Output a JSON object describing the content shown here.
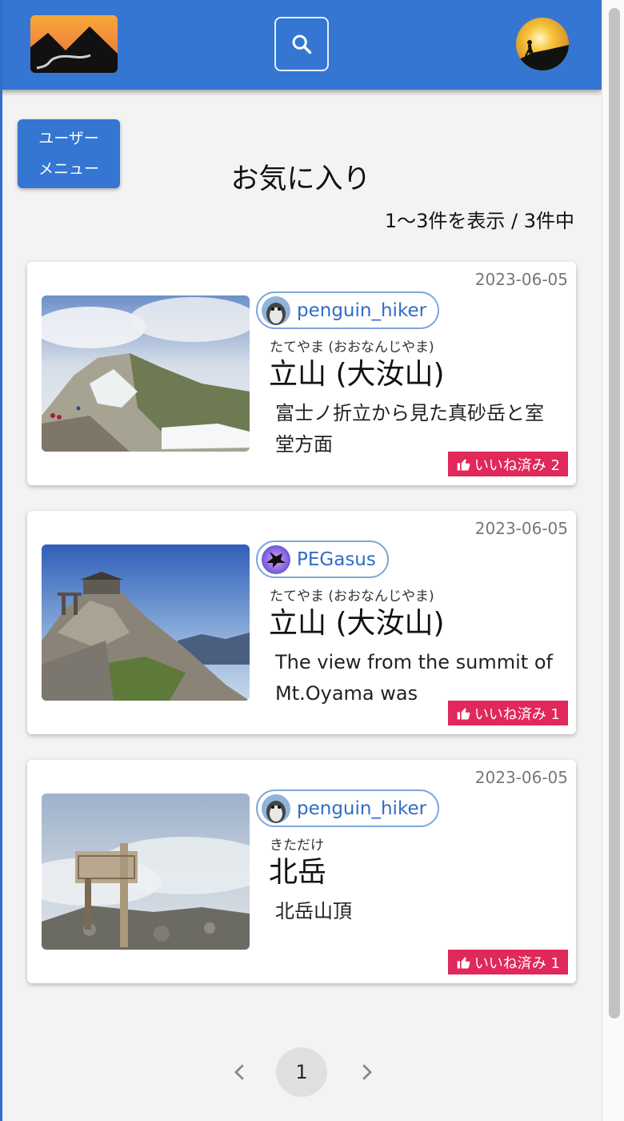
{
  "header": {
    "logo_icon": "mountain-logo",
    "search_icon": "search-icon",
    "avatar_icon": "hiker-avatar"
  },
  "user_menu": {
    "line1": "ユーザー",
    "line2": "メニュー"
  },
  "page": {
    "title": "お気に入り",
    "count_text": "1〜3件を表示 / 3件中"
  },
  "cards": [
    {
      "date": "2023-06-05",
      "user": "penguin_hiker",
      "user_avatar": "penguin-avatar",
      "reading": "たてやま (おおなんじやま)",
      "mountain": "立山 (大汝山)",
      "comment": "富士ノ折立から見た真砂岳と室堂方面",
      "like_label": "いいね済み 2"
    },
    {
      "date": "2023-06-05",
      "user": "PEGasus",
      "user_avatar": "pegasus-avatar",
      "reading": "たてやま (おおなんじやま)",
      "mountain": "立山 (大汝山)",
      "comment": "The view from the summit of Mt.Oyama was breathtaking！",
      "like_label": "いいね済み 1"
    },
    {
      "date": "2023-06-05",
      "user": "penguin_hiker",
      "user_avatar": "penguin-avatar",
      "reading": "きただけ",
      "mountain": "北岳",
      "comment": "北岳山頂",
      "like_label": "いいね済み 1"
    }
  ],
  "pagination": {
    "current_page": "1"
  },
  "colors": {
    "header": "#3476d2",
    "like": "#e0285a",
    "link": "#2f6cc7"
  }
}
